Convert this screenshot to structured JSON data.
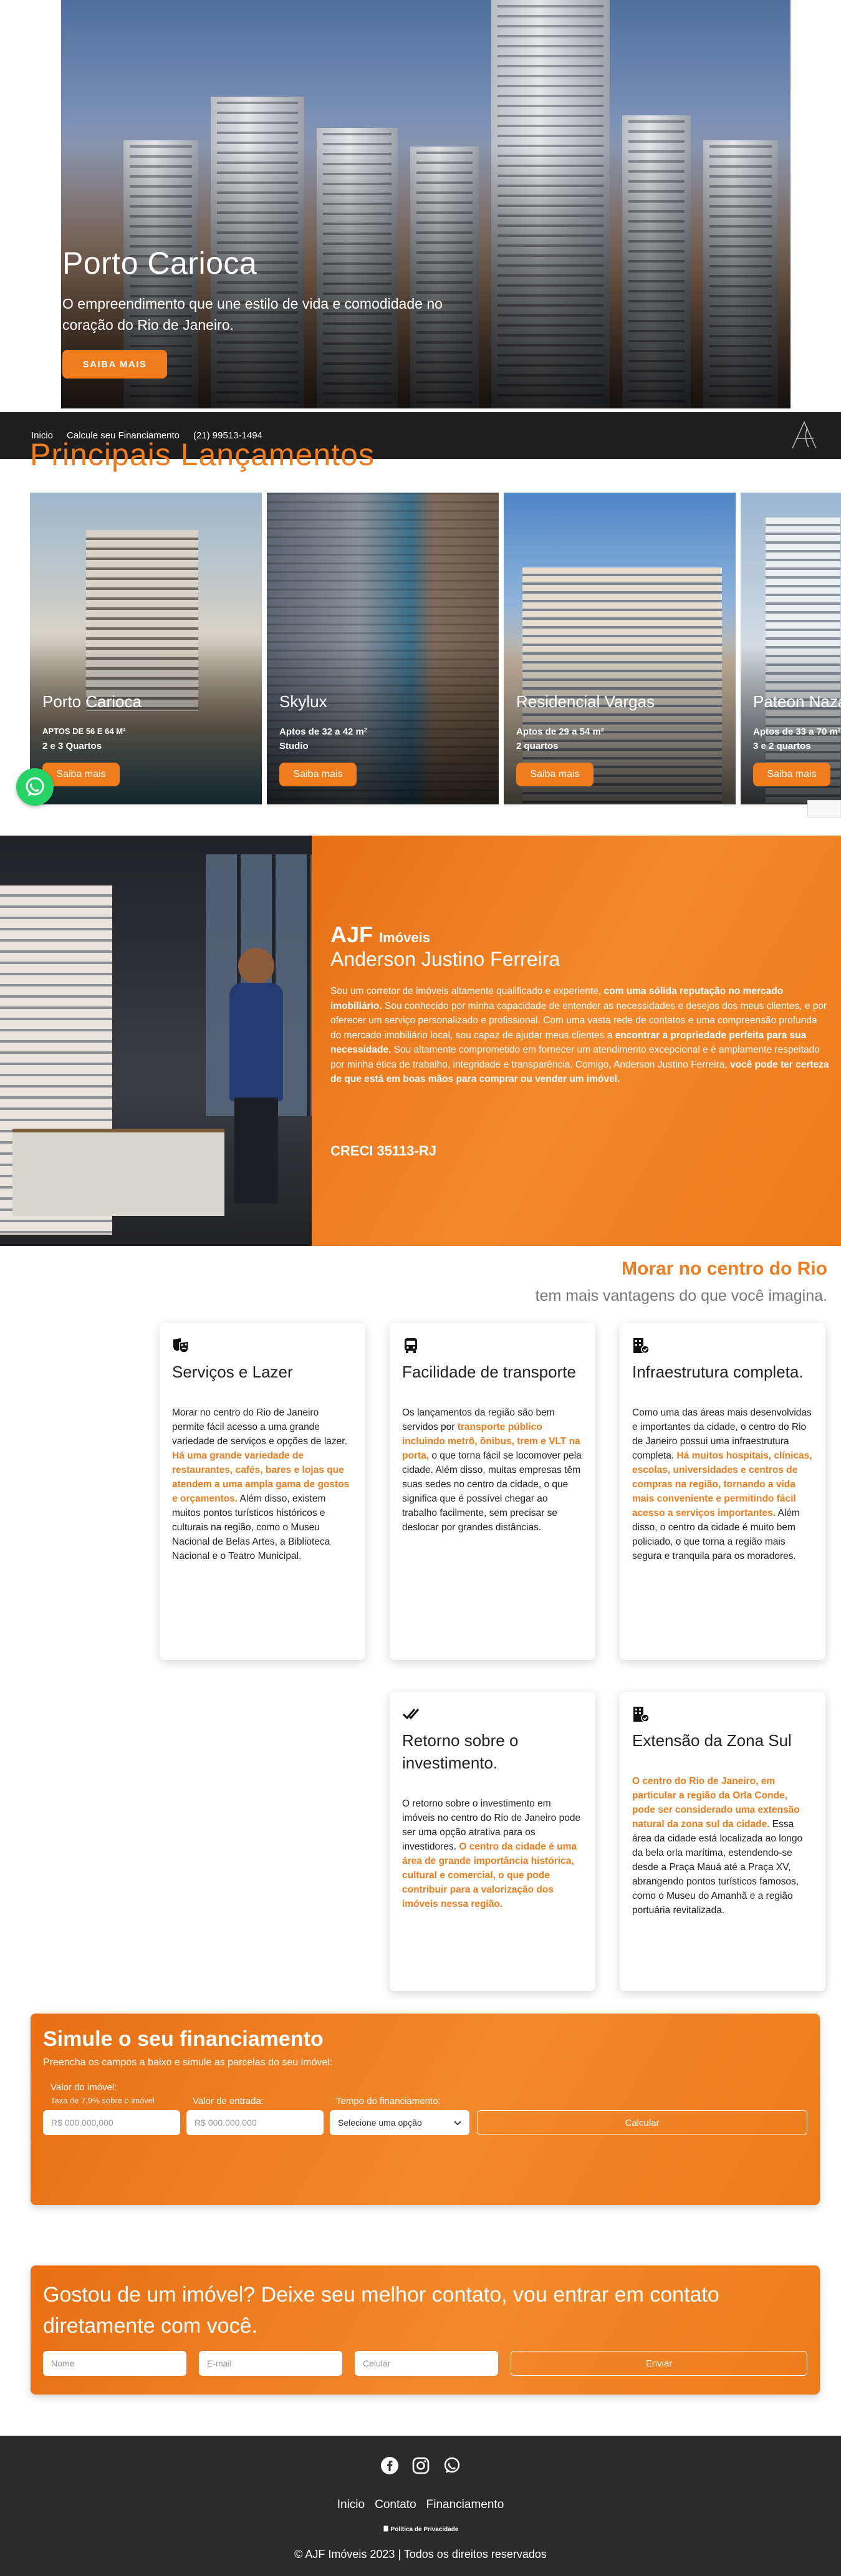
{
  "hero": {
    "title": "Porto Carioca",
    "subtitle": "O empreendimento que une estilo de vida e comodidade no coração do Rio de Janeiro.",
    "cta": "SAIBA MAIS",
    "next_icon": "chevron-right-icon"
  },
  "nav": {
    "links": [
      "Inicio",
      "Calcule seu Financiamento"
    ],
    "phone": "(21) 99513-1494",
    "logo_icon": "ajf-logo"
  },
  "launches": {
    "heading": "Principais Lançamentos",
    "cards": [
      {
        "name": "Porto Carioca",
        "size": "APTOS DE 56 E 64 M²",
        "rooms": "2 e 3 Quartos",
        "cta": "Saiba mais"
      },
      {
        "name": "Skylux",
        "size": "Aptos de 32 a 42 m²",
        "rooms": "Studio",
        "cta": "Saiba mais"
      },
      {
        "name": "Residencial Vargas",
        "size": "Aptos de 29 a 54 m²",
        "rooms": "2 quartos",
        "cta": "Saiba mais"
      },
      {
        "name": "Pateon Nazaré",
        "size": "Aptos de 33 a 70 m²",
        "rooms": "3 e 2 quartos",
        "cta": "Saiba mais"
      }
    ]
  },
  "about": {
    "brand": "AJF",
    "brand_suffix": "Imóveis",
    "name": "Anderson Justino Ferreira",
    "paragraph_1": "Sou um corretor de imóveis altamente qualificado e experiente, ",
    "bold_1": "com uma sólida reputação no mercado imobiliário.",
    "paragraph_2": " Sou conhecido por minha capacidade de entender as necessidades e desejos dos meus clientes, e por oferecer um serviço personalizado e profissional. Com uma vasta rede de contatos e uma compreensão profunda do mercado imobiliário local, sou capaz de ajudar meus clientes a ",
    "bold_2": "encontrar a propriedade perfeita para sua necessidade.",
    "paragraph_3": " Sou altamente comprometido em fornecer um atendimento excepcional e é amplamente respeitado por minha ética de trabalho, integridade e transparência. Comigo, Anderson Justino Ferreira, ",
    "bold_3": "você pode ter certeza de que está em boas mãos para comprar ou vender um imóvel.",
    "creci": "CRECI 35113-RJ"
  },
  "center": {
    "heading": "Morar no centro do Rio",
    "subheading": "tem mais vantagens do que você imagina.",
    "cards": [
      {
        "icon": "theater-masks-icon",
        "title": "Serviços e Lazer",
        "t1": "Morar no centro do Rio de Janeiro permite fácil acesso a uma grande variedade de serviços e opções de lazer. ",
        "h1": "Há uma grande variedade de restaurantes, cafés, bares e lojas que atendem a uma ampla gama de gostos e orçamentos.",
        "t2": " Além disso, existem muitos pontos turísticos históricos e culturais na região, como o Museu Nacional de Belas Artes, a Biblioteca Nacional e o Teatro Municipal."
      },
      {
        "icon": "bus-icon",
        "title": "Facilidade de transporte",
        "t1": "Os lançamentos da região são bem servidos por ",
        "h1": "transporte público incluindo metrô, ônibus, trem e VLT na porta,",
        "t2": " o que torna fácil se locomover pela cidade. Além disso, muitas empresas têm suas sedes no centro da cidade, o que significa que é possível chegar ao trabalho facilmente, sem precisar se deslocar por grandes distâncias."
      },
      {
        "icon": "building-check-icon",
        "title": "Infraestrutura completa.",
        "t1": "Como uma das áreas mais desenvolvidas e importantes da cidade, o centro do Rio de Janeiro possui uma infraestrutura completa. ",
        "h1": "Há muitos hospitais, clínicas, escolas, universidades e centros de compras na região, tornando a vida mais conveniente e permitindo fácil acesso a serviços importantes.",
        "t2": " Além disso, o centro da cidade é muito bem policiado, o que torna a região mais segura e tranquila para os moradores."
      },
      {
        "icon": "double-check-icon",
        "title": "Retorno sobre o investimento.",
        "t1": "O retorno sobre o investimento em imóveis no centro do Rio de Janeiro pode ser uma opção atrativa para os investidores. ",
        "h1": "O centro da cidade é uma área de grande importância histórica, cultural e comercial, o que pode contribuir para a valorização dos imóveis nessa região.",
        "t2": ""
      },
      {
        "icon": "building-check-icon",
        "title": "Extensão da Zona Sul",
        "t1": "",
        "h1": "O centro do Rio de Janeiro, em particular a região da Orla Conde, pode ser considerado uma extensão natural da zona sul da cidade.",
        "t2": " Essa área da cidade está localizada ao longo da bela orla marítima, estendendo-se desde a Praça Mauá até a Praça XV, abrangendo pontos turísticos famosos, como o Museu do Amanhã e a região portuária revitalizada."
      }
    ]
  },
  "simulator": {
    "title": "Simule o seu financiamento",
    "description": "Preencha os campos a baixo e simule as parcelas do seu imóvel:",
    "property_label": "Valor do imóvel:",
    "property_hint": "Taxa de 7,9% sobre o imóvel",
    "property_placeholder": "R$ 000.000,000",
    "down_label": "Valor de entrada:",
    "down_placeholder": "R$ 000.000,000",
    "term_label": "Tempo do financiamento:",
    "term_value": "Selecione uma opção",
    "submit": "Calcular"
  },
  "contact": {
    "title": "Gostou de um imóvel? Deixe seu melhor contato, vou entrar em contato diretamente com você.",
    "name_placeholder": "Nome",
    "email_placeholder": "E-mail",
    "phone_placeholder": "Celular",
    "submit": "Enviar"
  },
  "footer": {
    "social": [
      "facebook-icon",
      "instagram-icon",
      "whatsapp-icon"
    ],
    "links": [
      "Inicio",
      "Contato",
      "Financiamento"
    ],
    "privacy": "Política de Privacidade",
    "copyright": "© AJF Imóveis 2023 | Todos os direitos reservados"
  },
  "colors": {
    "accent": "#f07c1d",
    "dark": "#1e1e1e",
    "whatsapp": "#25d366"
  }
}
